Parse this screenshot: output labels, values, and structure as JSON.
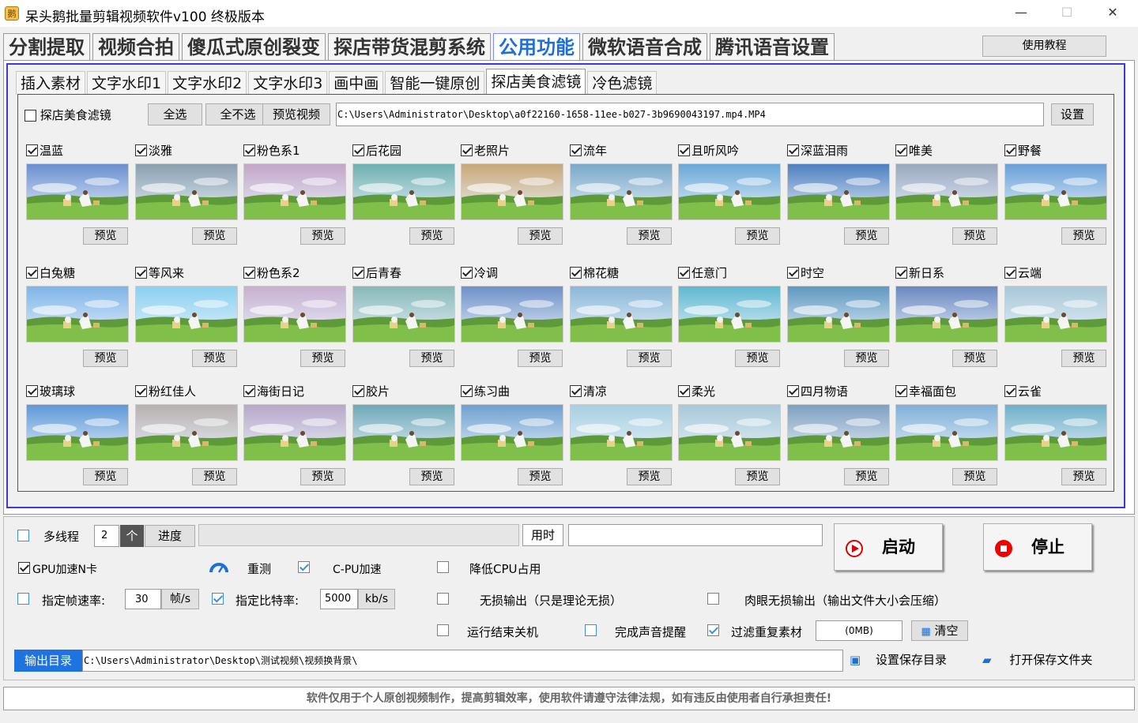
{
  "window": {
    "title": "呆头鹅批量剪辑视频软件v100 终极版本",
    "minimize": "—",
    "maximize": "☐",
    "close": "✕"
  },
  "main_tabs": [
    "分割提取",
    "视频合拍",
    "傻瓜式原创裂变",
    "探店带货混剪系统",
    "公用功能",
    "微软语音合成",
    "腾讯语音设置"
  ],
  "main_tab_active": 4,
  "tutorial_label": "使用教程",
  "sub_tabs": [
    "插入素材",
    "文字水印1",
    "文字水印2",
    "文字水印3",
    "画中画",
    "智能一键原创",
    "探店美食滤镜",
    "冷色滤镜"
  ],
  "sub_tab_active": 6,
  "filter_panel": {
    "enable_label": "探店美食滤镜",
    "enable_checked": false,
    "select_all": "全选",
    "deselect_all": "全不选",
    "preview_video": "预览视频",
    "video_path": "C:\\Users\\Administrator\\Desktop\\a0f22160-1658-11ee-b027-3b9690043197.mp4.MP4",
    "settings": "设置",
    "preview_label": "预览",
    "filters": [
      [
        "温蓝",
        "淡雅",
        "粉色系1",
        "后花园",
        "老照片",
        "流年",
        "且听风吟",
        "深蓝泪雨",
        "唯美",
        "野餐"
      ],
      [
        "白兔糖",
        "等风来",
        "粉色系2",
        "后青春",
        "冷调",
        "棉花糖",
        "任意门",
        "时空",
        "新日系",
        "云端"
      ],
      [
        "玻璃球",
        "粉红佳人",
        "海街日记",
        "胶片",
        "练习曲",
        "清凉",
        "柔光",
        "四月物语",
        "幸福面包",
        "云雀"
      ]
    ],
    "filter_tints": [
      [
        "#6a8fd0",
        "#8a9fb0",
        "#c2a6c8",
        "#6fb0b0",
        "#c8a878",
        "#7aa8c8",
        "#6aa8d8",
        "#4f7fbf",
        "#9aa8c0",
        "#6aa0d8"
      ],
      [
        "#7fb4e8",
        "#8ad0f0",
        "#c8b0d0",
        "#88b8b8",
        "#6f90c8",
        "#8ab8d8",
        "#5fb8d0",
        "#5f98c0",
        "#6a88c0",
        "#a8c8d8"
      ],
      [
        "#5f98d8",
        "#b8b0b0",
        "#b8a8c8",
        "#6fa8b8",
        "#6fa0d0",
        "#a8d0e0",
        "#a8c8d8",
        "#7fa0c0",
        "#7fb0d8",
        "#6fb0c8"
      ]
    ]
  },
  "bottom": {
    "multithread": "多线程",
    "thread_count": "2",
    "thread_unit": "个",
    "progress_label": "进度",
    "elapsed_label": "用时",
    "elapsed_value": "",
    "progress": 0,
    "start": "启动",
    "stop": "停止",
    "gpu_nvidia": "GPU加速N卡",
    "retest": "重测",
    "cpu_accel": "C-PU加速",
    "reduce_cpu": "降低CPU占用",
    "fps_label": "指定帧速率:",
    "fps_value": "30",
    "fps_unit": "帧/s",
    "bitrate_label": "指定比特率:",
    "bitrate_value": "5000",
    "bitrate_unit": "kb/s",
    "lossless": "无损输出（只是理论无损）",
    "visual_lossless": "肉眼无损输出（输出文件大小会压缩）",
    "shutdown": "运行结束关机",
    "sound_alert": "完成声音提醒",
    "filter_dup": "过滤重复素材",
    "dup_size": "(0MB)",
    "clear": "清空",
    "output_dir_label": "输出目录",
    "output_dir": "C:\\Users\\Administrator\\Desktop\\测试视频\\视频换背景\\",
    "set_save_dir": "设置保存目录",
    "open_save_dir": "打开保存文件夹"
  },
  "notice": "软件仅用于个人原创视频制作，提高剪辑效率，使用软件请遵守法律法规，如有违反由使用者自行承担责任!"
}
